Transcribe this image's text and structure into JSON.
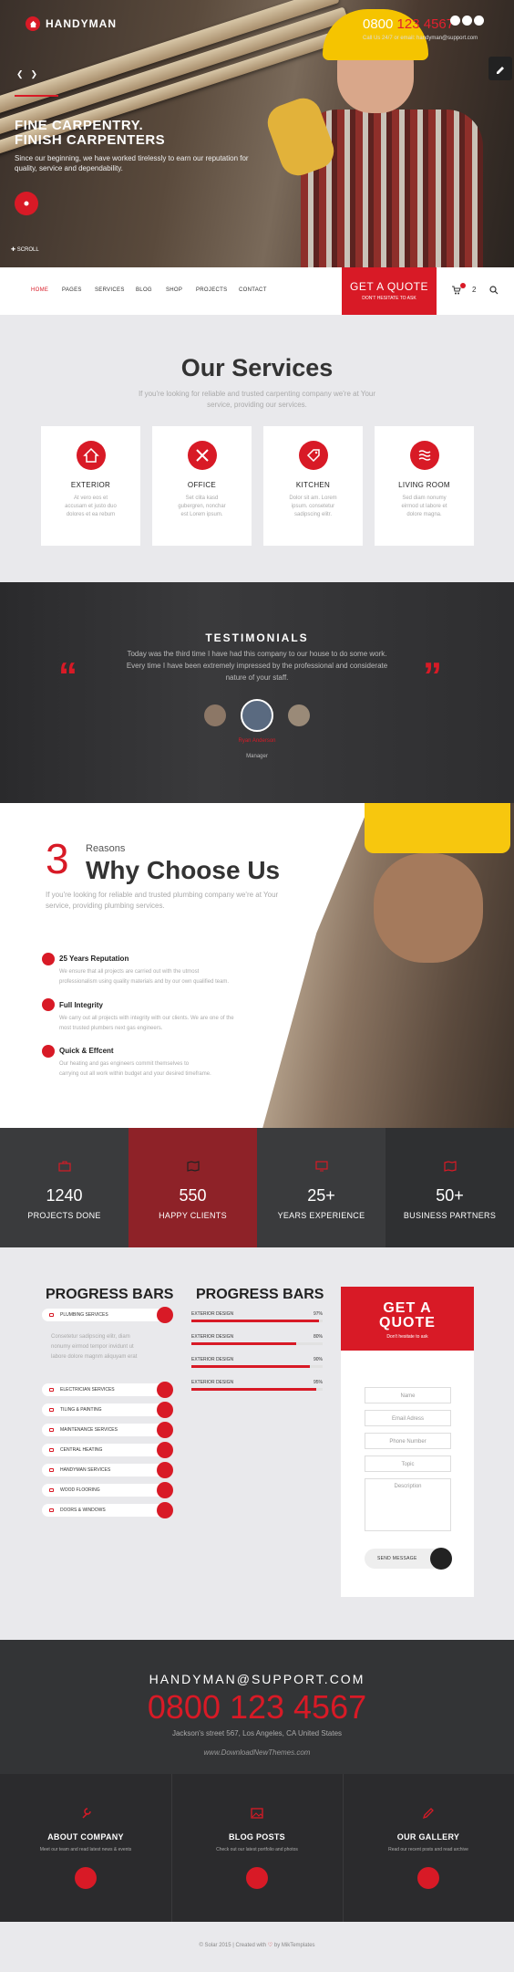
{
  "header": {
    "logo_text": "HANDYMAN",
    "phone_prefix": "0800",
    "phone_red": "123 4567",
    "call_line": "Call Us 24/7 or email: handyman@support.com",
    "hero_title_1": "FINE CARPENTRY.",
    "hero_title_2": "FINISH CARPENTERS",
    "hero_sub": "Since our beginning, we have worked tirelessly to earn our reputation for quality, service and dependability.",
    "scroll": "SCROLL"
  },
  "nav": {
    "items": [
      "HOME",
      "PAGES",
      "SERVICES",
      "BLOG",
      "SHOP",
      "PROJECTS",
      "CONTACT"
    ],
    "quote_title": "GET A QUOTE",
    "quote_sub": "DON'T HESITATE TO ASK",
    "cart_count": "2"
  },
  "services": {
    "title": "Our Services",
    "subtitle_1": "If you're looking for reliable and trusted carpenting company we're at Your",
    "subtitle_2": "service, providing our services.",
    "cards": [
      {
        "title": "EXTERIOR",
        "l1": "At vero eos et",
        "l2": "accusam et justo duo",
        "l3": "dolores et ea rebum",
        "icon": "home-icon"
      },
      {
        "title": "OFFICE",
        "l1": "Set clita kasd",
        "l2": "gubergren, nonchar",
        "l3": "est Lorem ipsum.",
        "icon": "tools-icon"
      },
      {
        "title": "KITCHEN",
        "l1": "Dolor sit am. Lorem",
        "l2": "ipsum. consetetur",
        "l3": "sadipscing elitr.",
        "icon": "tag-icon"
      },
      {
        "title": "LIVING ROOM",
        "l1": "Sed diam nonumy",
        "l2": "eirmod ut labore et",
        "l3": "dolore magna.",
        "icon": "waves-icon"
      }
    ]
  },
  "testimonials": {
    "title": "TESTIMONIALS",
    "text_1": "Today was the third time I have had this company to our house to do some work.",
    "text_2": "Every time I have been extremely impressed by the professional and considerate",
    "text_3": "nature of your staff.",
    "name": "Ryan Anderson",
    "role": "Manager"
  },
  "why": {
    "number": "3",
    "reasons": "Reasons",
    "title": "Why Choose Us",
    "sub_1": "If you're looking for reliable and trusted plumbing company we're at Your",
    "sub_2": "service, providing plumbing services.",
    "features": [
      {
        "title": "25 Years Reputation",
        "l1": "We ensure that all projects are carried out with the utmost",
        "l2": "professionalism using quality materials and by our own qualified team."
      },
      {
        "title": "Full Integrity",
        "l1": "We carry out all projects with integrity with our clients. We are one of the",
        "l2": "most trusted plumbers next gas engineers."
      },
      {
        "title": "Quick & Effcent",
        "l1": "Our heating and gas engineers commit themselves to",
        "l2": "carrying out all work within budget and your desired timeframe."
      }
    ]
  },
  "stats": [
    {
      "number": "1240",
      "label": "PROJECTS DONE",
      "color": "#3a3b3d"
    },
    {
      "number": "550",
      "label": "HAPPY CLIENTS",
      "color": "#8e2228"
    },
    {
      "number": "25+",
      "label": "YEARS EXPERIENCE",
      "color": "#3a3b3d"
    },
    {
      "number": "50+",
      "label": "BUSINESS PARTNERS",
      "color": "#2f3032"
    }
  ],
  "progress": {
    "title_left": "PROGRESS BARS",
    "title_mid": "PROGRESS BARS",
    "first_pill": "PLUMBING SERVICES",
    "text_1": "Consetetur sadipscing elitr, diam",
    "text_2": "nonumy eirmod tempor invidunt ut",
    "text_3": "labore dolore magnm aliquyam erat",
    "pills": [
      "ELECTRICIAN SERVICES",
      "TILING & PAINTING",
      "MAINTENANCE SERVICES",
      "CENTRAL HEATING",
      "HANDYMAN SERVICES",
      "WOOD FLOORING",
      "DOORS & WINDOWS"
    ],
    "bars": [
      {
        "label": "EXTERIOR DESIGN",
        "pct_text": "97%",
        "value": 0.97
      },
      {
        "label": "EXTERIOR DESIGN",
        "pct_text": "80%",
        "value": 0.8
      },
      {
        "label": "EXTERIOR DESIGN",
        "pct_text": "90%",
        "value": 0.9
      },
      {
        "label": "EXTERIOR DESIGN",
        "pct_text": "95%",
        "value": 0.95
      }
    ]
  },
  "quote_form": {
    "title_1": "GET A",
    "title_2": "QUOTE",
    "sub": "Don't hesitate to ask",
    "name_ph": "Name",
    "email_ph": "Email Adress",
    "phone_ph": "Phone Number",
    "topic_ph": "Topic",
    "desc_ph": "Description",
    "send": "SEND MESSAGE"
  },
  "contact": {
    "email": "HANDYMAN@SUPPORT.COM",
    "phone": "0800 123 4567",
    "address": "Jackson's street 567, Los Angeles, CA United States",
    "watermark": "www.DownloadNewThemes.com"
  },
  "footer": {
    "cols": [
      {
        "title": "ABOUT COMPANY",
        "text": "Meet our team and read latest news & events",
        "icon": "wrench-icon"
      },
      {
        "title": "BLOG POSTS",
        "text": "Check out our latest portfolio and photos",
        "icon": "image-icon"
      },
      {
        "title": "OUR GALLERY",
        "text": "Read our recent posts and read archive",
        "icon": "pencil-icon"
      }
    ],
    "copy_1": "© Solar 2015 | Created with",
    "copy_2": "by MikTemplates"
  },
  "colors": {
    "accent": "#d81a26",
    "dark": "#333436"
  }
}
